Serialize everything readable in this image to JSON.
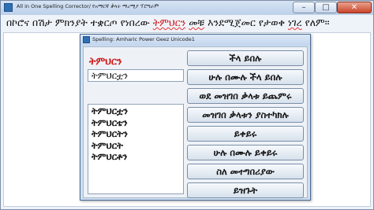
{
  "main_window": {
    "title": "All in One Spelling Corrector/ የአማርኛ ቃላት ማረሚያ ፕሮግራም",
    "minimize_glyph": "–",
    "maximize_glyph": "□",
    "close_glyph": "✕",
    "text": {
      "part1": "በኮሮና በሽታ ምክንያት ተቋርጦ የነበረው ",
      "err1": "ትምህርን",
      "space1": " ",
      "err2": "መቹ",
      "part2": " እንደሚጀመር የታወቀ ",
      "err3": "ነገረ",
      "part3": " የለም፡፡"
    }
  },
  "dialog": {
    "title": "Spelling: Amharic Power Geez Unicode1",
    "misspelled_word": "ትምህርን",
    "replacement_value": "ትምህርቷን",
    "suggestions": [
      "ትምህርቷን",
      "ትምህርቴን",
      "ትምህርትን",
      "ትምህርት",
      "ትምህርቶን"
    ],
    "buttons": {
      "ignore": "ችላ ይበሉ",
      "ignore_all": "ሁሉ በሙሉ ችላ ይበሉ",
      "add_to_dictionary": "ወደ መዝገበ ቃላቱ ይጨምሩ",
      "edit_dictionary": "መዝገበ ቃላቱን ያስተካክሉ",
      "change": "ይቀይሩ",
      "change_all": "ሁሉ በሙሉ ይቀይሩ",
      "about": "ስለ መተግበሪያው",
      "close": "ይዝጉት"
    }
  },
  "colors": {
    "error_red": "#d01b1b",
    "dialog_background": "#cfdff0"
  }
}
